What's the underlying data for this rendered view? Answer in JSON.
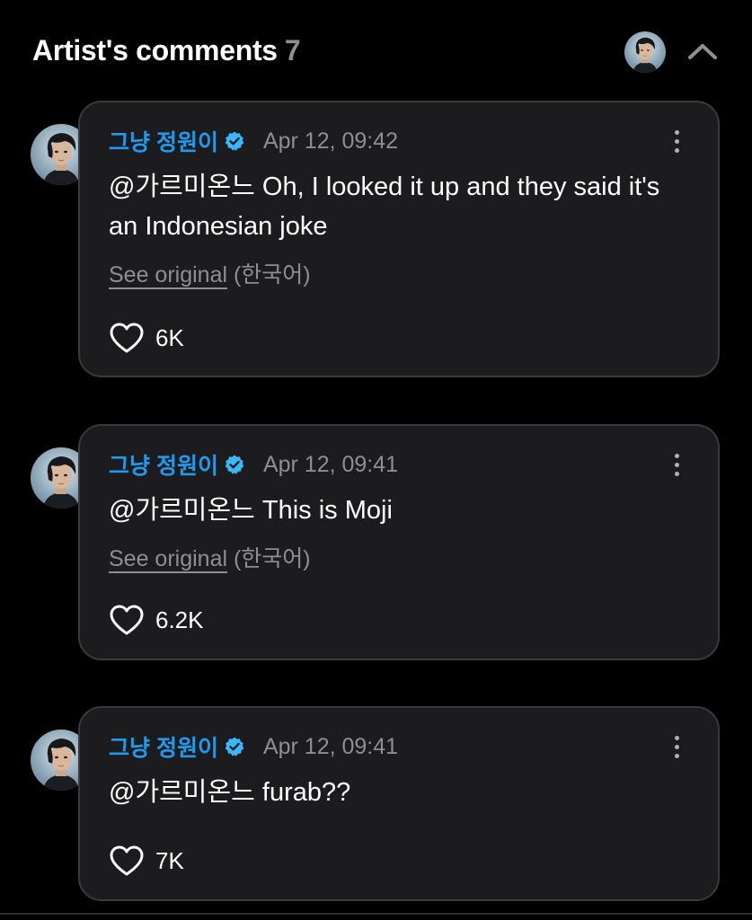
{
  "header": {
    "title": "Artist's comments",
    "count": "7"
  },
  "comments": [
    {
      "author": "그냥 정원이",
      "timestamp": "Apr 12, 09:42",
      "mention": "@가르미온느",
      "text": " Oh, I looked it up and they said it's an Indonesian joke",
      "see_original": "See original",
      "language": "(한국어)",
      "likes": "6K"
    },
    {
      "author": "그냥 정원이",
      "timestamp": "Apr 12, 09:41",
      "mention": "@가르미온느",
      "text": " This is Moji",
      "see_original": "See original",
      "language": "(한국어)",
      "likes": "6.2K"
    },
    {
      "author": "그냥 정원이",
      "timestamp": "Apr 12, 09:41",
      "mention": "@가르미온느",
      "text": " furab??",
      "likes": "7K"
    }
  ],
  "icons": {
    "verified": "verified-badge-icon",
    "more": "more-vertical-icon",
    "like": "heart-icon",
    "collapse": "chevron-up-icon"
  },
  "colors": {
    "background": "#000000",
    "card": "#1c1c1e",
    "author": "#1e9bf0",
    "verified": "#3ab8ff",
    "muted": "#8e8e93"
  }
}
